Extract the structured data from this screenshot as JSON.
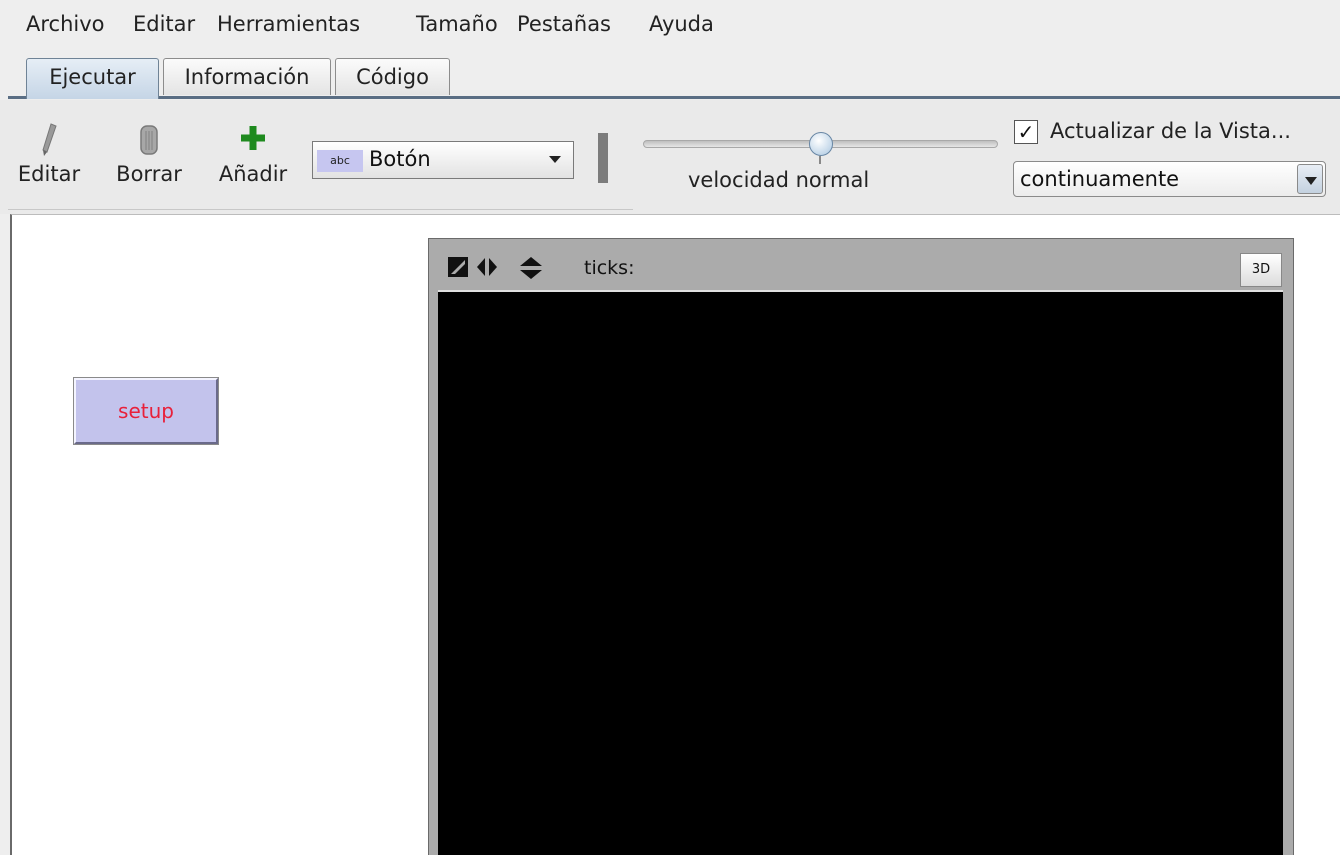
{
  "menu": [
    "Archivo",
    "Editar",
    "Herramientas",
    "Tamaño",
    "Pestañas",
    "Ayuda"
  ],
  "tabs": [
    {
      "label": "Ejecutar",
      "active": true
    },
    {
      "label": "Información",
      "active": false
    },
    {
      "label": "Código",
      "active": false
    }
  ],
  "toolbar": {
    "edit_label": "Editar",
    "delete_label": "Borrar",
    "add_label": "Añadir",
    "widget_badge": "abc",
    "widget_type": "Botón",
    "speed_label": "velocidad normal",
    "speed_value": 0.5,
    "update_checkbox_label": "Actualizar de la Vista...",
    "update_checked": true,
    "update_checkmark": "✓",
    "update_mode": "continuamente"
  },
  "interface": {
    "setup_button": "setup",
    "view": {
      "ticks_label": "ticks:",
      "button_3d": "3D"
    }
  },
  "colors": {
    "accent": "#5a6e84",
    "add_icon": "#1e8a1e",
    "setup_text": "#e8203a",
    "setup_bg": "#c3c3ec",
    "view_bg": "#000000"
  }
}
